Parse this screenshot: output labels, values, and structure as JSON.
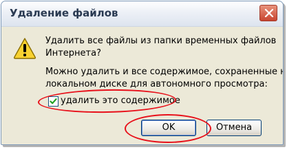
{
  "dialog": {
    "title": "Удаление файлов",
    "message_line1": "Удалить все файлы из папки временных файлов\nИнтернета?",
    "message_line2": "Можно удалить и все содержимое, сохраненные на\nлокальном диске для автономного просмотра:",
    "checkbox_label": "удалить это содержимое",
    "checkbox_checked": true,
    "ok_label": "OK",
    "cancel_label": "Отмена"
  },
  "icons": {
    "close": "close-icon",
    "warning": "warning-icon",
    "checkmark": "checkmark-icon"
  },
  "colors": {
    "dialog_bg": "#ece9d8",
    "close_button": "#c8442f",
    "warning_yellow": "#f8d231",
    "annotation_red": "#e8101a",
    "checkmark_green": "#21a121"
  }
}
